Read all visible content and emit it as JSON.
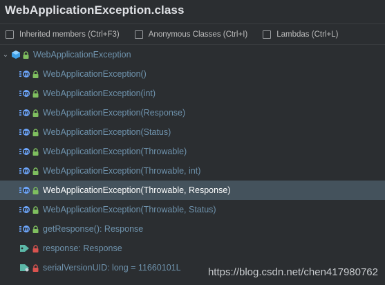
{
  "title": "WebApplicationException.class",
  "options": [
    {
      "label": "Inherited members (Ctrl+F3)",
      "checked": false
    },
    {
      "label": "Anonymous Classes (Ctrl+I)",
      "checked": false
    },
    {
      "label": "Lambdas (Ctrl+L)",
      "checked": false
    }
  ],
  "root": {
    "label": "WebApplicationException",
    "icon": "class-icon"
  },
  "members": [
    {
      "label": "WebApplicationException()",
      "icon": "method-icon"
    },
    {
      "label": "WebApplicationException(int)",
      "icon": "method-icon"
    },
    {
      "label": "WebApplicationException(Response)",
      "icon": "method-icon"
    },
    {
      "label": "WebApplicationException(Status)",
      "icon": "method-icon"
    },
    {
      "label": "WebApplicationException(Throwable)",
      "icon": "method-icon"
    },
    {
      "label": "WebApplicationException(Throwable, int)",
      "icon": "method-icon"
    },
    {
      "label": "WebApplicationException(Throwable, Response)",
      "icon": "method-icon",
      "selected": true
    },
    {
      "label": "WebApplicationException(Throwable, Status)",
      "icon": "method-icon"
    },
    {
      "label": "getResponse(): Response",
      "icon": "method-icon"
    },
    {
      "label": "response: Response",
      "icon": "field-icon"
    },
    {
      "label": "serialVersionUID: long = 11660101L",
      "icon": "static-field-icon"
    }
  ],
  "watermark": "https://blog.csdn.net/chen417980762",
  "colors": {
    "background": "#2b2e31",
    "selected_row": "#44525c",
    "member_text": "#6f93ad",
    "lock_public": "#7fbf5f",
    "lock_private": "#d9534f",
    "method_badge": "#6ea8ff"
  }
}
